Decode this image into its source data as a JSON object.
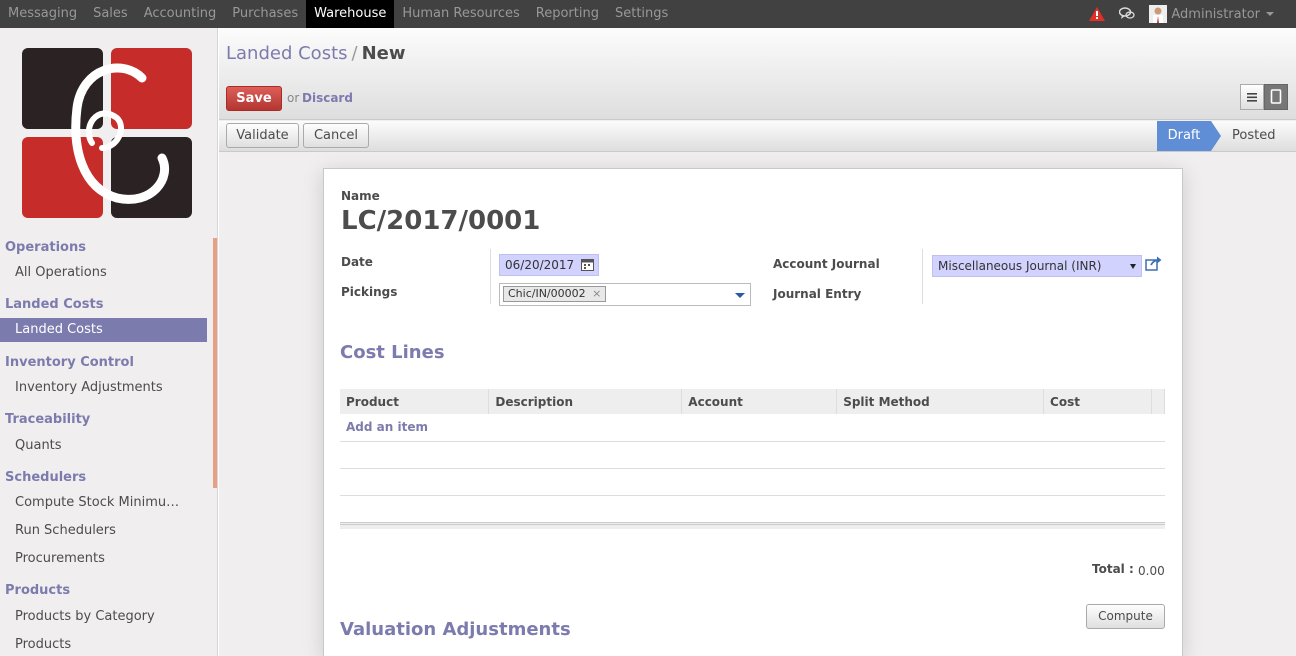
{
  "topnav": {
    "items": [
      "Messaging",
      "Sales",
      "Accounting",
      "Purchases",
      "Warehouse",
      "Human Resources",
      "Reporting",
      "Settings"
    ],
    "active_index": 4,
    "user_name": "Administrator"
  },
  "sidebar": {
    "sections": [
      {
        "title": "Operations",
        "items": [
          "All Operations"
        ]
      },
      {
        "title": "Landed Costs",
        "items": [
          "Landed Costs"
        ]
      },
      {
        "title": "Inventory Control",
        "items": [
          "Inventory Adjustments"
        ]
      },
      {
        "title": "Traceability",
        "items": [
          "Quants"
        ]
      },
      {
        "title": "Schedulers",
        "items": [
          "Compute Stock Minimu…",
          "Run Schedulers",
          "Procurements"
        ]
      },
      {
        "title": "Products",
        "items": [
          "Products by Category",
          "Products"
        ]
      }
    ],
    "active_item": "Landed Costs"
  },
  "header": {
    "breadcrumb_parent": "Landed Costs",
    "breadcrumb_sep": "/",
    "breadcrumb_current": "New",
    "save_label": "Save",
    "or_text": "or",
    "discard_label": "Discard"
  },
  "statusbar": {
    "validate_label": "Validate",
    "cancel_label": "Cancel",
    "stages": [
      "Draft",
      "Posted"
    ],
    "current_stage": "Draft"
  },
  "form": {
    "name_label": "Name",
    "name_value": "LC/2017/0001",
    "date_label": "Date",
    "date_value": "06/20/2017",
    "pickings_label": "Pickings",
    "pickings_tag": "Chic/IN/00002",
    "account_journal_label": "Account Journal",
    "account_journal_value": "Miscellaneous Journal (INR)",
    "journal_entry_label": "Journal Entry",
    "cost_lines_title": "Cost Lines",
    "columns": [
      "Product",
      "Description",
      "Account",
      "Split Method",
      "Cost"
    ],
    "add_item_label": "Add an item",
    "total_label": "Total :",
    "total_value": "0.00",
    "compute_label": "Compute",
    "valuation_title": "Valuation Adjustments"
  },
  "colors": {
    "accent": "#7c7bad",
    "save": "#c9413b",
    "draft_stage": "#5f8ed6",
    "logo_red": "#c62d2a",
    "logo_dark": "#2a2223"
  }
}
